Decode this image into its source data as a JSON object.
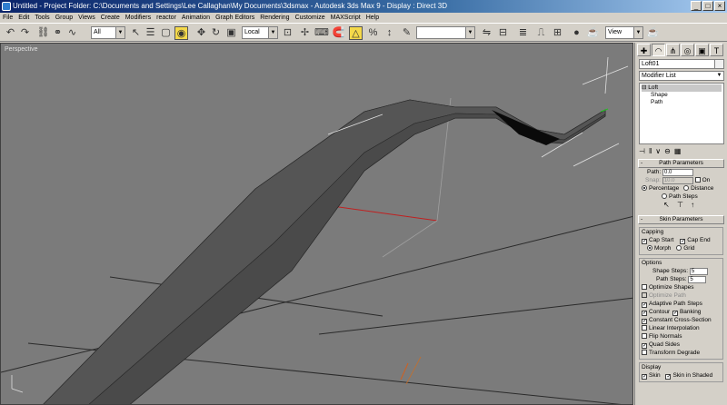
{
  "window": {
    "title": "Untitled    - Project Folder: C:\\Documents and Settings\\Lee Callaghan\\My Documents\\3dsmax    - Autodesk 3ds Max 9    - Display : Direct 3D",
    "controls": [
      "_",
      "□",
      "×"
    ]
  },
  "menu": [
    "File",
    "Edit",
    "Tools",
    "Group",
    "Views",
    "Create",
    "Modifiers",
    "reactor",
    "Animation",
    "Graph Editors",
    "Rendering",
    "Customize",
    "MAXScript",
    "Help"
  ],
  "toolbar": {
    "selection_filter": "All",
    "coordinate_system": "Local",
    "named_selection": "",
    "render_mode": "View"
  },
  "viewport": {
    "label": "Perspective",
    "background_color": "#7b7b7b"
  },
  "command_panel": {
    "object_name": "Loft01",
    "object_color": "#f0f0f0",
    "modifier_list": "Modifier List",
    "stack": [
      "Loft",
      "Shape",
      "Path"
    ],
    "path_parameters": {
      "title": "Path Parameters",
      "path_label": "Path:",
      "path_value": "0.0",
      "snap_label": "Snap:",
      "snap_value": "10.0",
      "on_label": "On",
      "percentage_label": "Percentage",
      "distance_label": "Distance",
      "path_steps_label": "Path Steps"
    },
    "skin_parameters": {
      "title": "Skin Parameters",
      "capping_label": "Capping",
      "cap_start_label": "Cap Start",
      "cap_end_label": "Cap End",
      "morph_label": "Morph",
      "grid_label": "Grid",
      "options_label": "Options",
      "shape_steps_label": "Shape Steps:",
      "shape_steps_value": "5",
      "path_steps_label": "Path Steps:",
      "path_steps_value": "5",
      "optimize_shapes": "Optimize Shapes",
      "optimize_path": "Optimize Path",
      "adaptive_path_steps": "Adaptive Path Steps",
      "contour": "Contour",
      "banking": "Banking",
      "constant_cross_section": "Constant Cross-Section",
      "linear_interpolation": "Linear Interpolation",
      "flip_normals": "Flip Normals",
      "quad_sides": "Quad Sides",
      "transform_degrade": "Transform Degrade",
      "display_label": "Display",
      "skin_label": "Skin",
      "skin_in_shaded_label": "Skin in Shaded"
    }
  }
}
